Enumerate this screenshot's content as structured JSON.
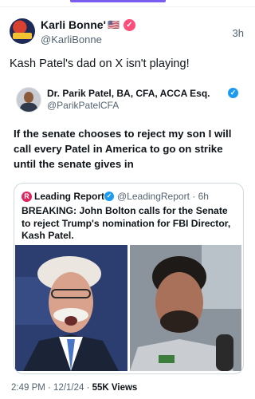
{
  "post": {
    "author_name": "Karli Bonne'",
    "flag": "🇺🇸",
    "handle": "@KarliBonne",
    "time": "3h",
    "text": "Kash Patel's dad on X isn't playing!"
  },
  "quote": {
    "author_name": "Dr. Parik Patel, BA, CFA, ACCA Esq.",
    "handle": "@ParikPatelCFA",
    "text": "If the senate chooses to reject my son I will call every Patel in America to go on strike until the senate gives in",
    "inner": {
      "source_name": "Leading Report",
      "source_meta": "@LeadingReport · 6h",
      "headline": "BREAKING: John Bolton calls for the Senate to reject Trump's nomination for FBI Director, Kash Patel."
    }
  },
  "meta": {
    "timestamp": "2:49 PM · 12/1/24 · ",
    "views": "55K Views"
  },
  "colors": {
    "accent": "#7b5cf0",
    "verified_blue": "#1d9bf0",
    "verified_pink": "#ff4d79"
  }
}
